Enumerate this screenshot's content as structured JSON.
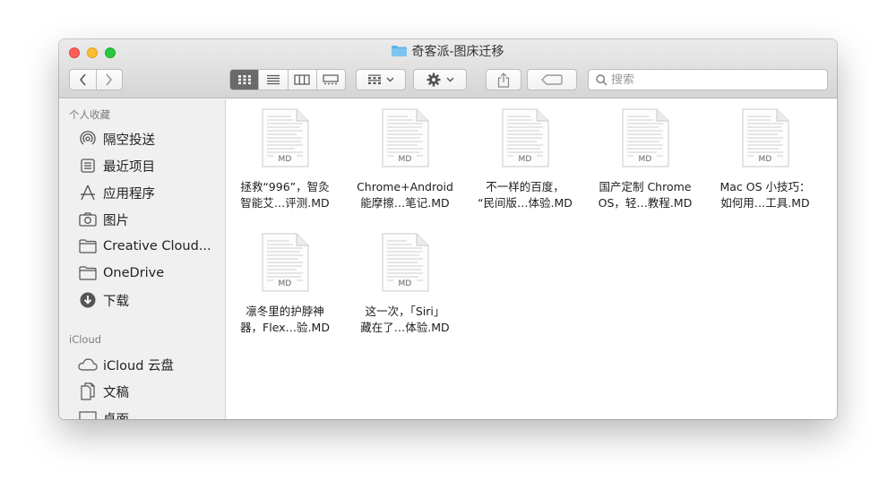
{
  "window": {
    "title": "奇客派-图床迁移",
    "accent": "#5ab1ec"
  },
  "toolbar": {
    "back_icon": "chevron-left-icon",
    "forward_icon": "chevron-right-icon",
    "views": [
      "icon-view-icon",
      "list-view-icon",
      "column-view-icon",
      "gallery-view-icon"
    ],
    "active_view": "icon-view-icon",
    "group_icon": "group-by-icon",
    "action_icon": "gear-icon",
    "share_icon": "share-icon",
    "tag_icon": "tag-icon"
  },
  "search": {
    "placeholder": "搜索",
    "value": ""
  },
  "sidebar": {
    "favorites_heading": "个人收藏",
    "favorites": [
      {
        "label": "隔空投送",
        "icon": "airdrop-icon"
      },
      {
        "label": "最近项目",
        "icon": "recents-icon"
      },
      {
        "label": "应用程序",
        "icon": "applications-icon"
      },
      {
        "label": "图片",
        "icon": "camera-icon"
      },
      {
        "label": "Creative Cloud...",
        "icon": "folder-icon"
      },
      {
        "label": "OneDrive",
        "icon": "folder-icon"
      },
      {
        "label": "下载",
        "icon": "download-icon"
      }
    ],
    "icloud_heading": "iCloud",
    "icloud": [
      {
        "label": "iCloud 云盘",
        "icon": "cloud-icon"
      },
      {
        "label": "文稿",
        "icon": "documents-icon"
      },
      {
        "label": "桌面",
        "icon": "desktop-icon"
      }
    ]
  },
  "files": [
    {
      "line1": "拯救“996”，智灸",
      "line2": "智能艾…评测.MD",
      "ext": "MD"
    },
    {
      "line1": "Chrome+Android",
      "line2": "能摩擦…笔记.MD",
      "ext": "MD"
    },
    {
      "line1": "不一样的百度，",
      "line2": "“民间版…体验.MD",
      "ext": "MD"
    },
    {
      "line1": "国产定制 Chrome",
      "line2": "OS，轻…教程.MD",
      "ext": "MD"
    },
    {
      "line1": "Mac OS 小技巧：",
      "line2": "如何用…工具.MD",
      "ext": "MD"
    },
    {
      "line1": "凛冬里的护脖神",
      "line2": "器，Flex…验.MD",
      "ext": "MD"
    },
    {
      "line1": "这一次，「Siri」",
      "line2": "藏在了…体验.MD",
      "ext": "MD"
    }
  ]
}
